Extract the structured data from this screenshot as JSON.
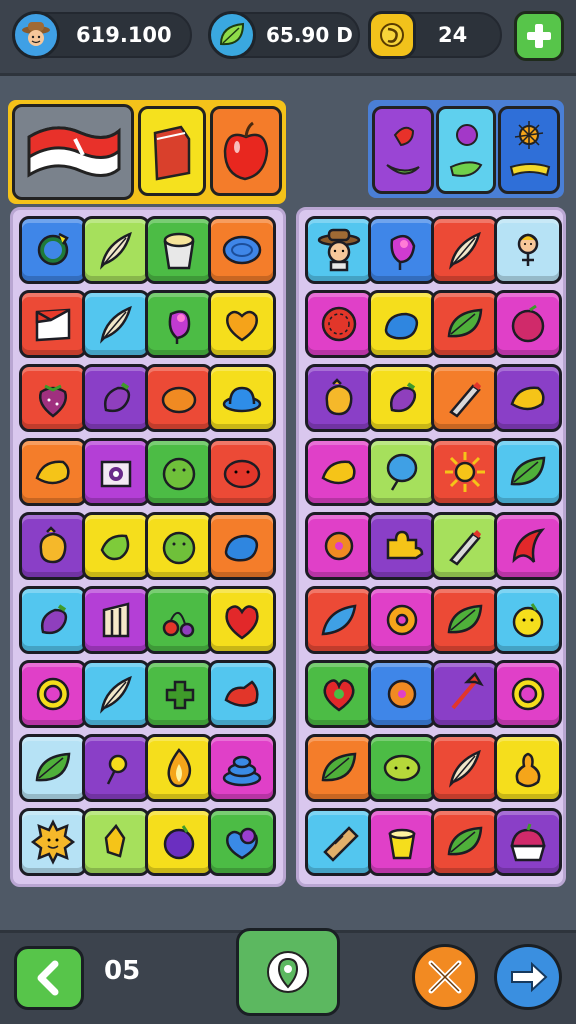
{
  "resources": {
    "coins": "619.100",
    "gems": "65.90 D",
    "tokens": "24"
  },
  "level_label": "05",
  "left_board": [
    [
      "blue",
      "green-circle"
    ],
    [
      "lime",
      "feather"
    ],
    [
      "green",
      "bucket"
    ],
    [
      "orange",
      "blue-oval"
    ],
    [
      "red",
      "flag"
    ],
    [
      "sky",
      "feather"
    ],
    [
      "green",
      "purple-bird"
    ],
    [
      "yellow",
      "heart-orange"
    ],
    [
      "red",
      "strawberry"
    ],
    [
      "purple",
      "eggplant"
    ],
    [
      "red",
      "orange-blob"
    ],
    [
      "yellow",
      "blue-hat"
    ],
    [
      "orange",
      "lemon"
    ],
    [
      "violet",
      "eye"
    ],
    [
      "green",
      "green-ball"
    ],
    [
      "red",
      "red-blob"
    ],
    [
      "purple",
      "chick"
    ],
    [
      "yellow",
      "green-fruit"
    ],
    [
      "yellow",
      "green-ball"
    ],
    [
      "orange",
      "blue-blob"
    ],
    [
      "sky",
      "eggplant"
    ],
    [
      "violet",
      "gate"
    ],
    [
      "green",
      "cherries"
    ],
    [
      "yellow",
      "heart-red"
    ],
    [
      "magenta",
      "ring"
    ],
    [
      "sky",
      "feather"
    ],
    [
      "green",
      "leaf-puzzle"
    ],
    [
      "sky",
      "red-shoe"
    ],
    [
      "paleblue",
      "leaf"
    ],
    [
      "purple",
      "lollipop"
    ],
    [
      "yellow",
      "flame"
    ],
    [
      "magenta",
      "blue-cake"
    ],
    [
      "paleblue",
      "sun-face"
    ],
    [
      "lime",
      "star-shard"
    ],
    [
      "yellow",
      "purple-ball"
    ],
    [
      "green",
      "blue-heart"
    ]
  ],
  "right_board": [
    [
      "sky",
      "cowboy"
    ],
    [
      "blue",
      "pink-bird"
    ],
    [
      "red",
      "feather"
    ],
    [
      "paleblue",
      "girl"
    ],
    [
      "magenta",
      "red-wheel"
    ],
    [
      "yellow",
      "blue-blob"
    ],
    [
      "red",
      "leaf"
    ],
    [
      "magenta",
      "plum"
    ],
    [
      "purple",
      "chick"
    ],
    [
      "yellow",
      "eggplant"
    ],
    [
      "orange",
      "pen"
    ],
    [
      "purple",
      "lemon"
    ],
    [
      "magenta",
      "lemon"
    ],
    [
      "lime",
      "blue-balloon"
    ],
    [
      "red",
      "sun"
    ],
    [
      "sky",
      "leaf"
    ],
    [
      "magenta",
      "orange-ball"
    ],
    [
      "purple",
      "puzzle"
    ],
    [
      "lime",
      "pen"
    ],
    [
      "magenta",
      "red-leaf"
    ],
    [
      "red",
      "blue-leaf"
    ],
    [
      "magenta",
      "donut"
    ],
    [
      "red",
      "leaf"
    ],
    [
      "sky",
      "yellow-face"
    ],
    [
      "green",
      "red-heart"
    ],
    [
      "blue",
      "orange-ball"
    ],
    [
      "purple",
      "arrow"
    ],
    [
      "magenta",
      "ring"
    ],
    [
      "orange",
      "leaf"
    ],
    [
      "green",
      "lime-oval"
    ],
    [
      "red",
      "feather"
    ],
    [
      "yellow",
      "pear"
    ],
    [
      "sky",
      "bandage"
    ],
    [
      "magenta",
      "yellow-cup"
    ],
    [
      "red",
      "leaf"
    ],
    [
      "purple",
      "cake"
    ]
  ],
  "colors": {
    "blue": "#3f86e8",
    "lime": "#a6e05c",
    "green": "#4cbc45",
    "orange": "#f47d2a",
    "red": "#ec4a36",
    "sky": "#53c6ef",
    "yellow": "#f5de1c",
    "purple": "#8a3fc7",
    "violet": "#b43fd6",
    "magenta": "#e040c8",
    "paleblue": "#b6e2f5"
  }
}
